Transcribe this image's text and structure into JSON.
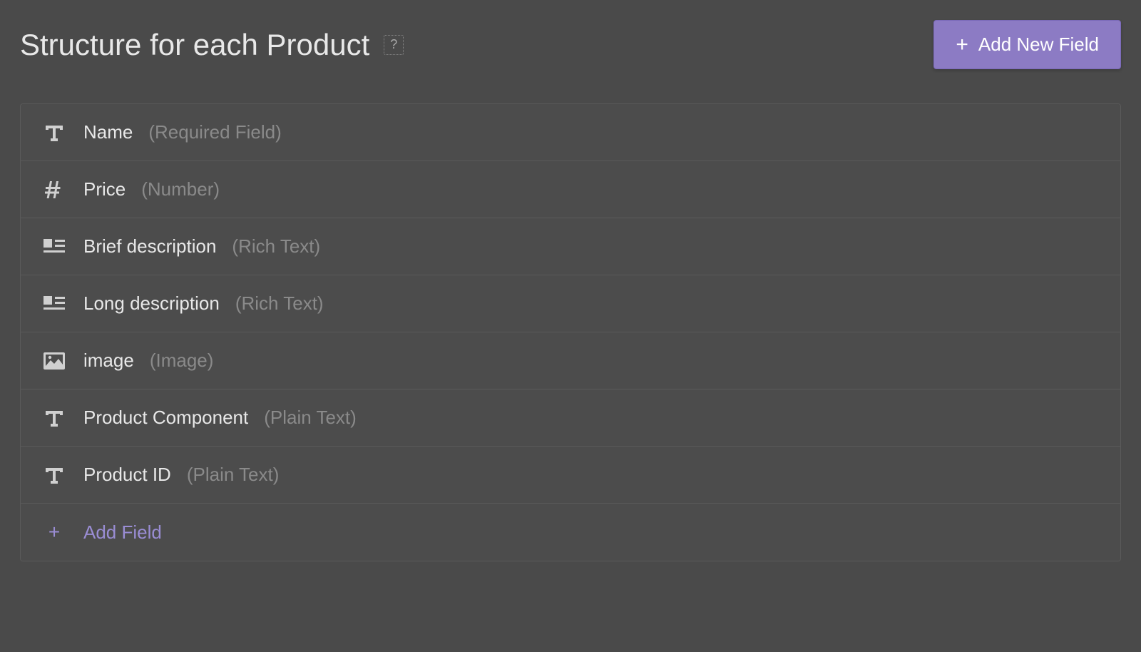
{
  "header": {
    "title": "Structure for each Product",
    "help_label": "?",
    "add_button_label": "Add New Field"
  },
  "fields": [
    {
      "icon": "text",
      "name": "Name",
      "type": "(Required Field)"
    },
    {
      "icon": "hash",
      "name": "Price",
      "type": "(Number)"
    },
    {
      "icon": "richtext",
      "name": "Brief description",
      "type": "(Rich Text)"
    },
    {
      "icon": "richtext",
      "name": "Long description",
      "type": "(Rich Text)"
    },
    {
      "icon": "image",
      "name": "image",
      "type": "(Image)"
    },
    {
      "icon": "text",
      "name": "Product Component",
      "type": "(Plain Text)"
    },
    {
      "icon": "text",
      "name": "Product ID",
      "type": "(Plain Text)"
    }
  ],
  "footer": {
    "add_field_label": "Add Field"
  }
}
